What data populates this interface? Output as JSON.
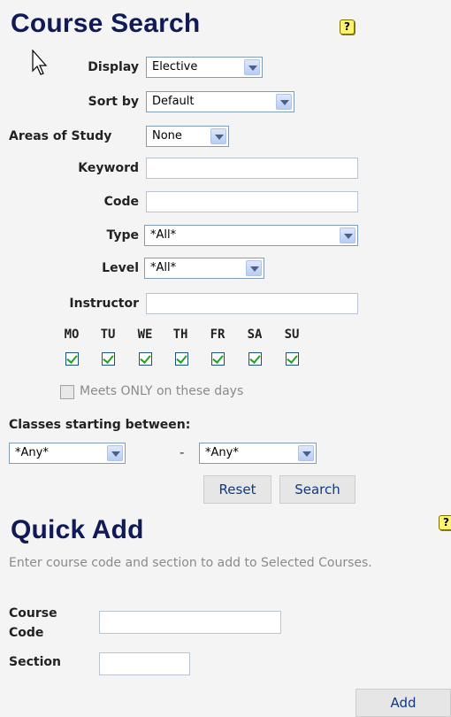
{
  "course_search": {
    "title": "Course Search",
    "help_glyph": "?",
    "display_label": "Display",
    "display_value": "Elective",
    "sortby_label": "Sort by",
    "sortby_value": "Default",
    "areas_label": "Areas of Study",
    "areas_value": "None",
    "keyword_label": "Keyword",
    "keyword_value": "",
    "code_label": "Code",
    "code_value": "",
    "type_label": "Type",
    "type_value": "*All*",
    "level_label": "Level",
    "level_value": "*All*",
    "instructor_label": "Instructor",
    "instructor_value": "",
    "days": [
      {
        "label": "MO",
        "checked": true
      },
      {
        "label": "TU",
        "checked": true
      },
      {
        "label": "WE",
        "checked": true
      },
      {
        "label": "TH",
        "checked": true
      },
      {
        "label": "FR",
        "checked": true
      },
      {
        "label": "SA",
        "checked": true
      },
      {
        "label": "SU",
        "checked": true
      }
    ],
    "meets_only_label": "Meets ONLY on these days",
    "meets_only_checked": false,
    "classes_between_label": "Classes starting between:",
    "start_from_value": "*Any*",
    "range_separator": "-",
    "start_to_value": "*Any*",
    "reset_label": "Reset",
    "search_label": "Search"
  },
  "quick_add": {
    "title": "Quick Add",
    "help_glyph": "?",
    "description": "Enter course code and section to add to Selected Courses.",
    "course_code_label": "Course Code",
    "course_code_value": "",
    "section_label": "Section",
    "section_value": "",
    "add_label": "Add"
  },
  "colors": {
    "heading": "#0f1a56",
    "button_text": "#0c3a84",
    "help_icon": "#fff36a",
    "check": "#21a121"
  },
  "icons": [
    "help-icon",
    "mouse-cursor-icon",
    "dropdown-arrow-icon",
    "checkmark-icon"
  ]
}
